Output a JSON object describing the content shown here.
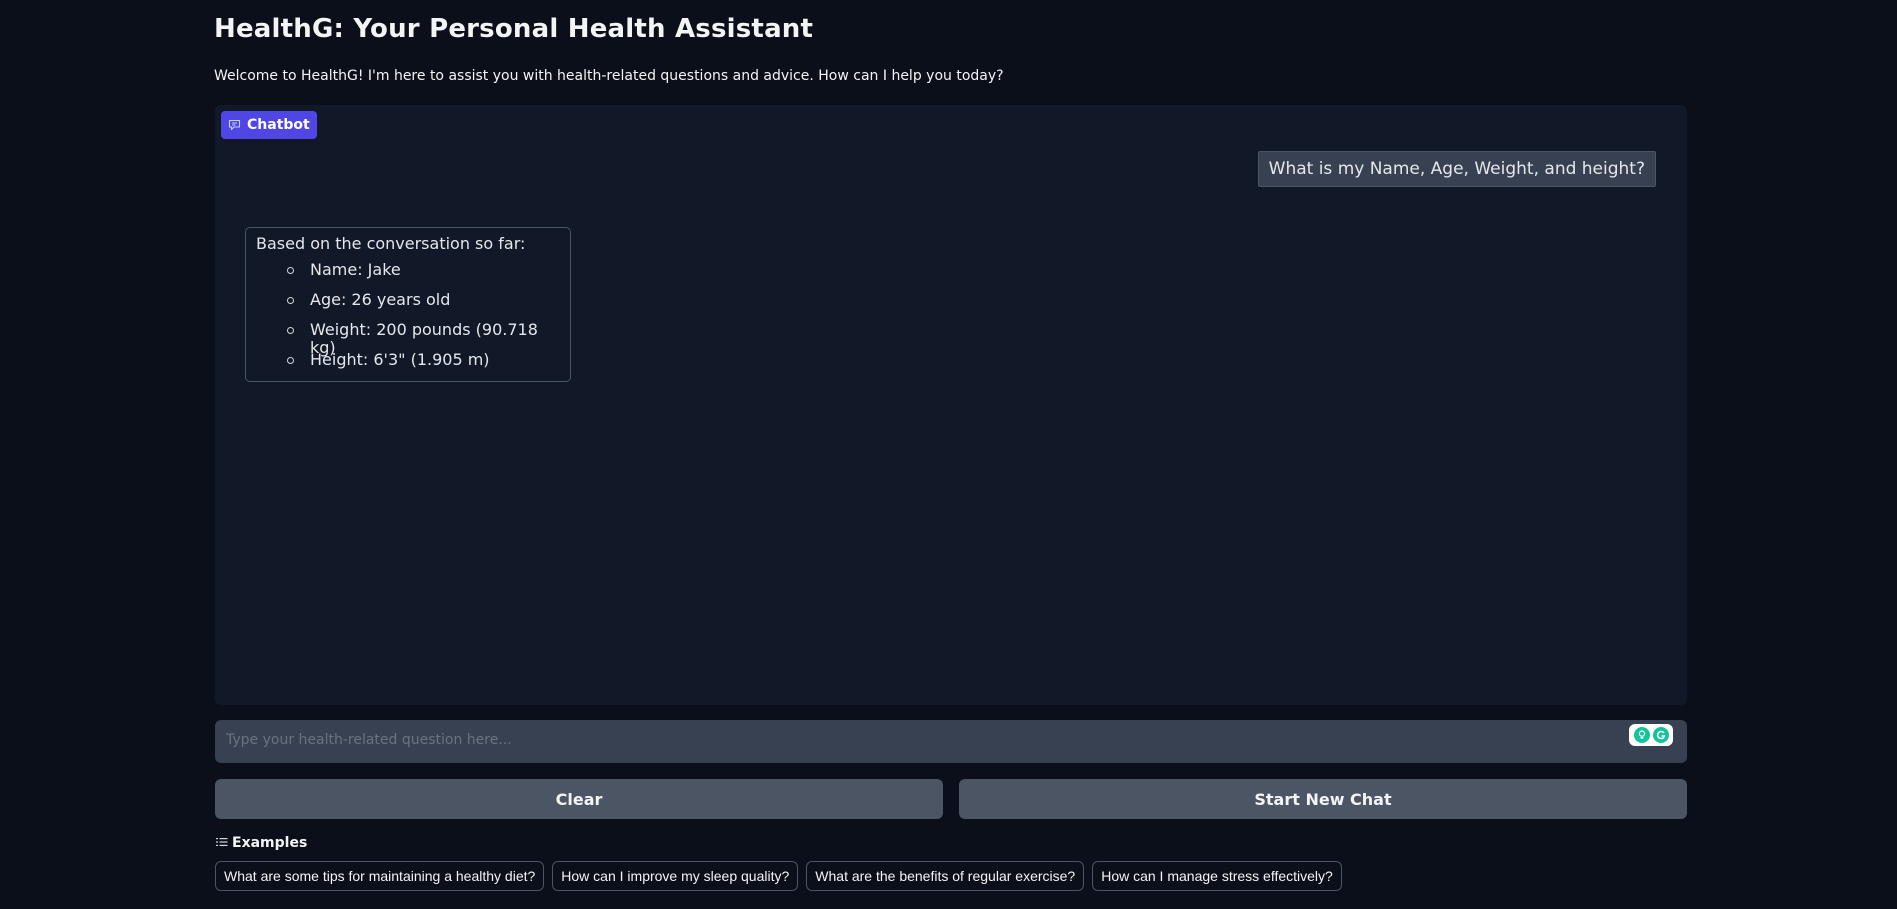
{
  "header": {
    "title": "HealthG: Your Personal Health Assistant",
    "subtitle": "Welcome to HealthG! I'm here to assist you with health-related questions and advice. How can I help you today?"
  },
  "chatbot": {
    "label": "Chatbot",
    "icon": "chat-bubble-icon",
    "accent_color": "#4f46e5",
    "messages": [
      {
        "role": "user",
        "text": "What is my Name, Age, Weight, and height?"
      },
      {
        "role": "bot",
        "intro": "Based on the conversation so far:",
        "items": [
          "Name: Jake",
          "Age: 26 years old",
          "Weight: 200 pounds (90.718 kg)",
          "Height: 6'3\" (1.905 m)"
        ]
      }
    ]
  },
  "input": {
    "value": "",
    "placeholder": "Type your health-related question here...",
    "extension_icon": "grammarly-icon"
  },
  "buttons": {
    "clear": "Clear",
    "new_chat": "Start New Chat"
  },
  "examples": {
    "label": "Examples",
    "icon": "list-icon",
    "items": [
      "What are some tips for maintaining a healthy diet?",
      "How can I improve my sleep quality?",
      "What are the benefits of regular exercise?",
      "How can I manage stress effectively?"
    ]
  }
}
